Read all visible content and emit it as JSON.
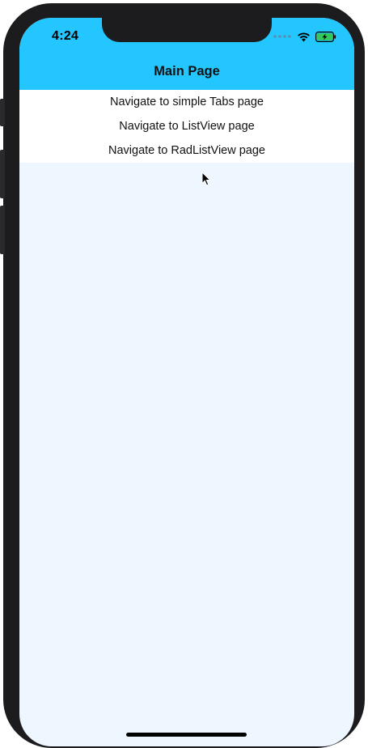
{
  "status_bar": {
    "time": "4:24",
    "icons": [
      "cellular-dots-icon",
      "wifi-icon",
      "battery-charging-icon"
    ]
  },
  "header": {
    "title": "Main Page",
    "background": "#23c6ff"
  },
  "menu": {
    "items": [
      {
        "label": "Navigate to simple Tabs page"
      },
      {
        "label": "Navigate to ListView page"
      },
      {
        "label": "Navigate to RadListView page"
      }
    ]
  },
  "colors": {
    "content_background": "#eef6ff",
    "battery_fill": "#34c759"
  }
}
